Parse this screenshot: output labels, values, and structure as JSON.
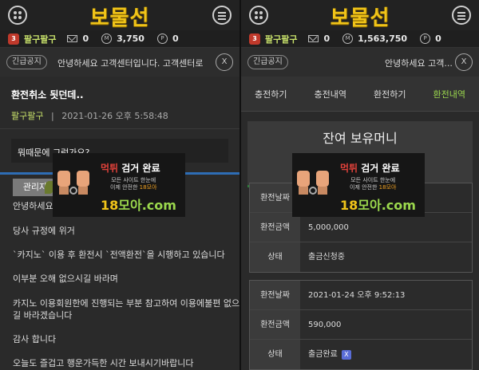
{
  "header": {
    "logo": "보물선"
  },
  "left": {
    "user": {
      "level": "3",
      "name": "팔구팔구",
      "messages": "0",
      "money": "3,750",
      "points": "0",
      "money_icon": "M",
      "points_icon": "P"
    },
    "notice": {
      "tag": "긴급공지",
      "text": "안녕하세요 고객센터입니다. 고객센터로",
      "close": "X"
    },
    "post": {
      "title": "환전취소 됫던데..",
      "author": "팔구팔구",
      "separator": "|",
      "date": "2021-01-26 오후 5:58:48",
      "question": "뭐때문에 그런가요?",
      "admin_tag": "관리자",
      "lines": [
        "안녕하세요",
        "당사 규정에 위거",
        "`카지노` 이용 후 환전시 `전액환전`을 시행하고 있습니다",
        "이부분 오해 없으시길 바라며",
        "카지노 이용회원한에 진행되는 부분 참고하여 이용에불편 없으시",
        "길 바라겠습니다",
        "감사 합니다",
        "오늘도 즐겁고 행운가득한 시간 보내시기바랍니다"
      ]
    }
  },
  "right": {
    "user": {
      "level": "3",
      "name": "팔구팔구",
      "messages": "0",
      "money": "1,563,750",
      "points": "0",
      "money_icon": "M",
      "points_icon": "P"
    },
    "notice": {
      "tag": "긴급공지",
      "text": "안녕하세요 고객...",
      "close": "X"
    },
    "tabs": [
      "충전하기",
      "충전내역",
      "환전하기",
      "환전내역"
    ],
    "balance_title": "잔여 보유머니",
    "record1": {
      "date_label": "환전날짜",
      "amount_label": "환전금액",
      "amount": "5,000,000",
      "status_label": "상태",
      "status": "출금신청중"
    },
    "record2": {
      "date_label": "환전날짜",
      "date": "2021-01-24 오후 9:52:13",
      "amount_label": "환전금액",
      "amount": "590,000",
      "status_label": "상태",
      "status": "출금완료",
      "badge": "X"
    }
  },
  "overlay": {
    "line1_accent": "먹튀",
    "line1": " 검거 완료",
    "line2a": "모든 사이트 한눈에",
    "line2b": "이제 안전한 ",
    "line2c": "18모아",
    "site_a": "18",
    "site_b": "모아",
    "site_c": ".com"
  }
}
